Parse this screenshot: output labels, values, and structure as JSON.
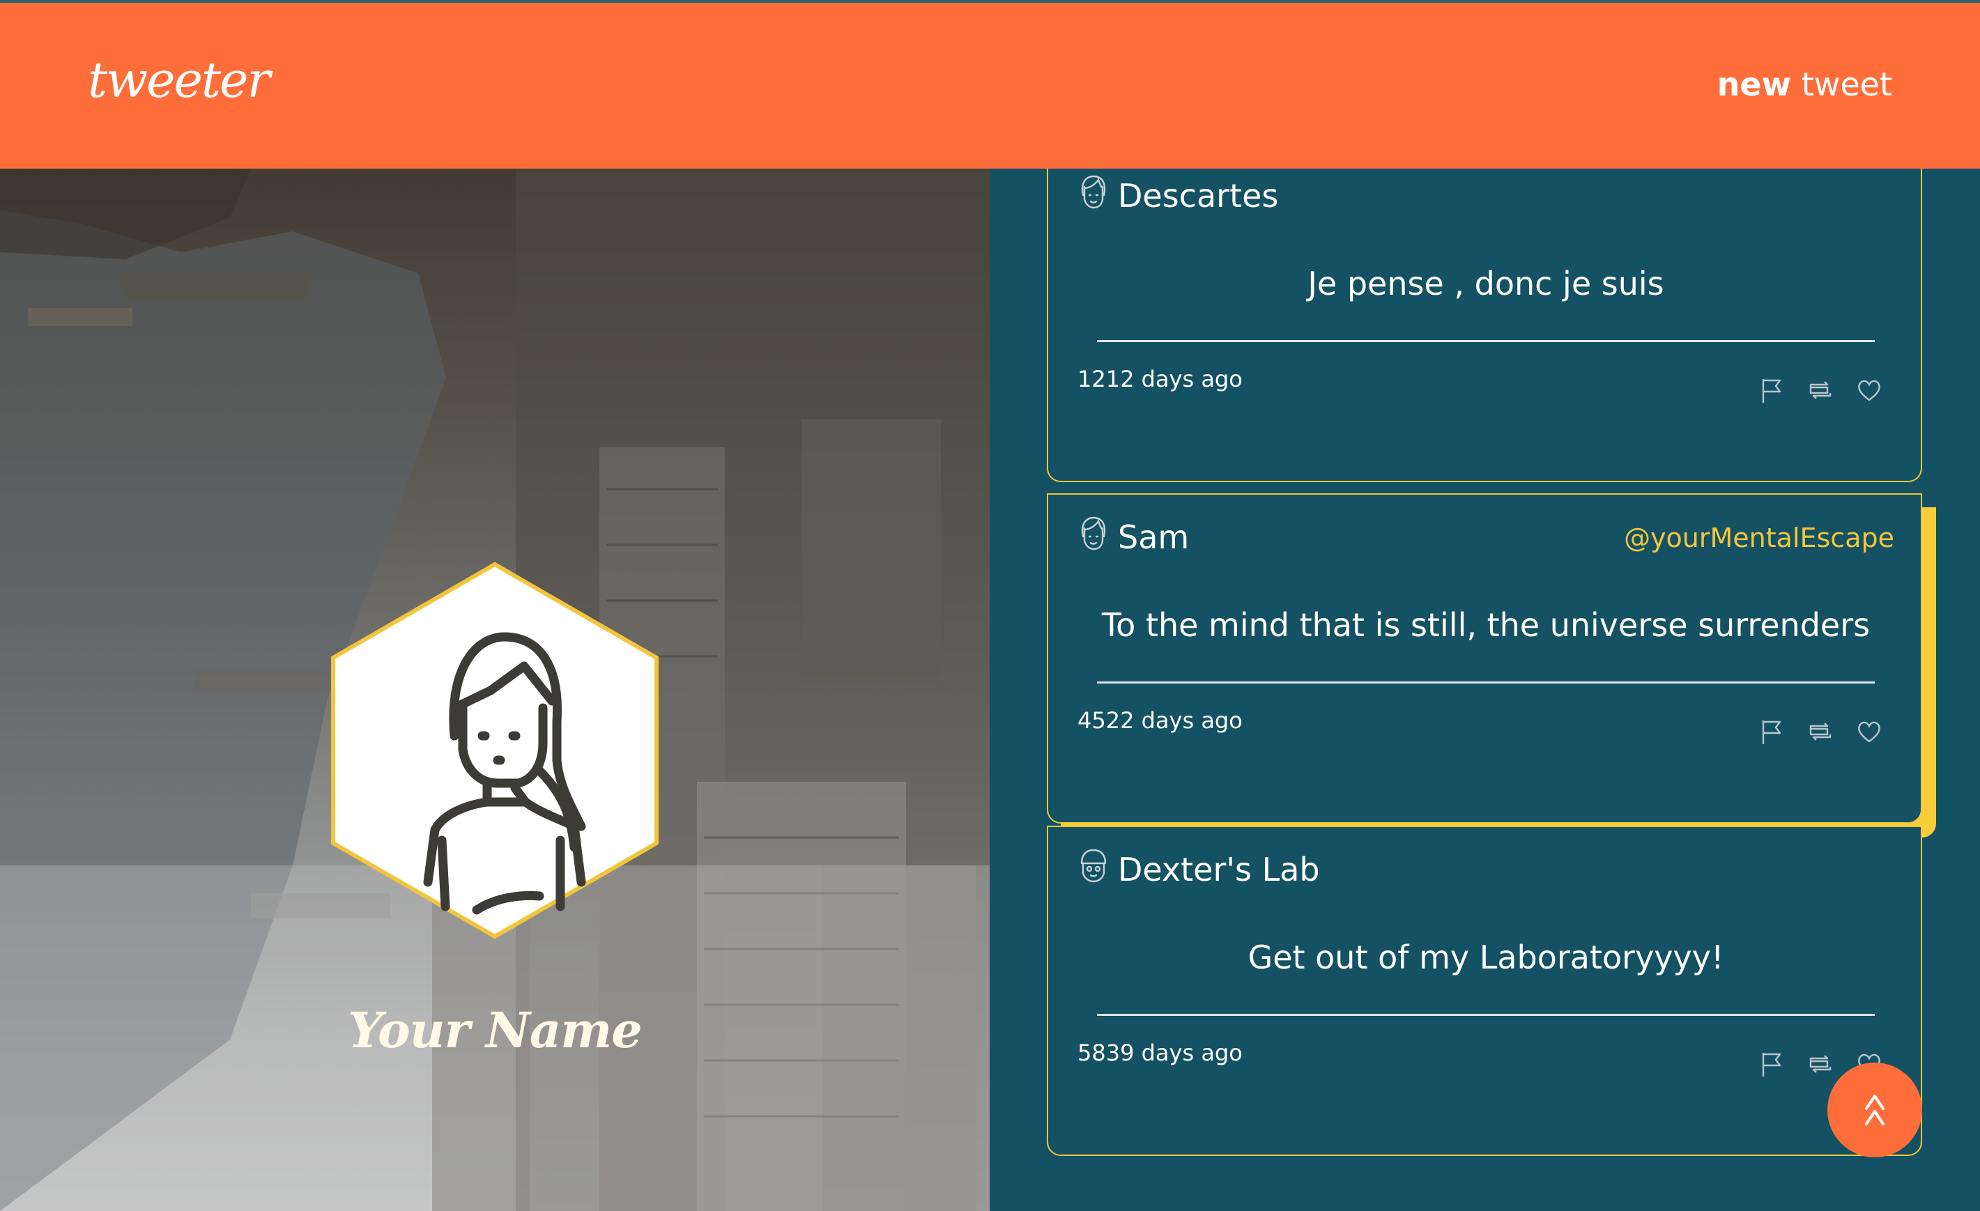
{
  "header": {
    "logo": "tweeter",
    "new_tweet_bold": "new",
    "new_tweet_rest": " tweet"
  },
  "profile": {
    "name": "Your Name"
  },
  "tweets": [
    {
      "author": "Descartes",
      "handle": "",
      "text": "Je pense , donc je suis",
      "time": "1212 days ago"
    },
    {
      "author": "Sam",
      "handle": "@yourMentalEscape",
      "text": "To the mind that is still, the universe surrenders",
      "time": "4522 days ago"
    },
    {
      "author": "Dexter's Lab",
      "handle": "",
      "text": "Get out of my Laboratoryyyy!",
      "time": "5839 days ago"
    }
  ],
  "scroll_top": {
    "label": "^^"
  },
  "colors": {
    "accent_orange": "#ff6e3a",
    "feed_background": "#145163",
    "highlight_yellow": "#f9cc3a",
    "handle_yellow": "#f2c63c"
  },
  "icons": {
    "tweet_avatar": "face-outline-icon",
    "flag": "flag-icon",
    "retweet": "retweet-icon",
    "like": "heart-icon",
    "scroll_top": "double-chevron-up-icon"
  }
}
